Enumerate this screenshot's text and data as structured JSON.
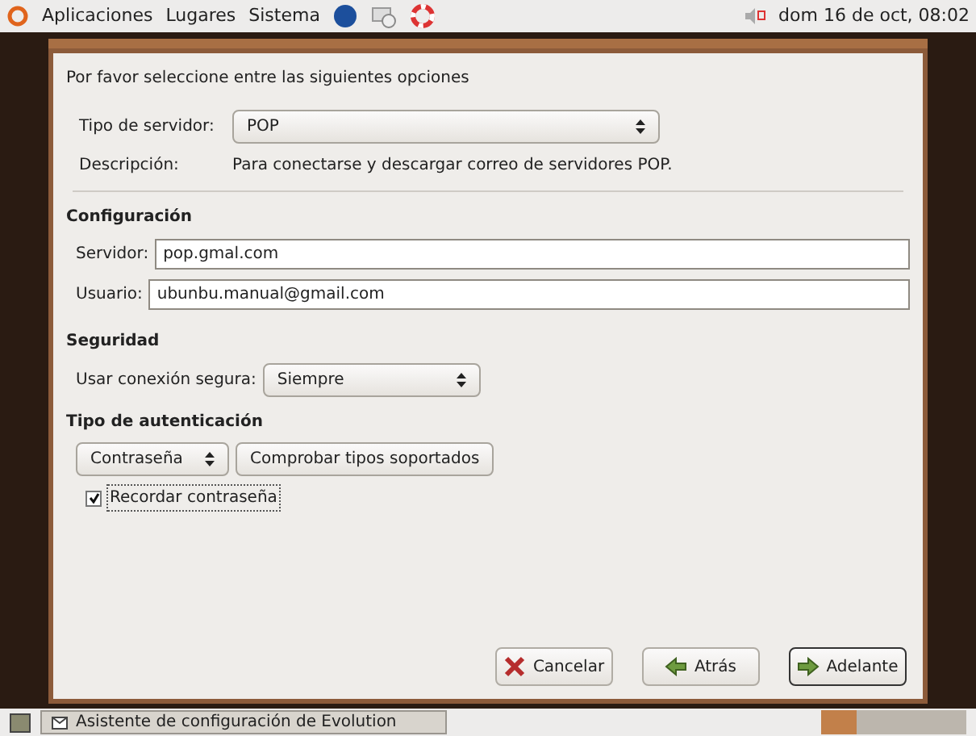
{
  "top_panel": {
    "menus": [
      "Aplicaciones",
      "Lugares",
      "Sistema"
    ],
    "clock": "dom 16 de oct, 08:02"
  },
  "intro": "Por favor seleccione entre las siguientes opciones",
  "server_type": {
    "label": "Tipo de servidor:",
    "value": "POP"
  },
  "description": {
    "label": "Descripción:",
    "text": "Para conectarse y descargar correo de servidores POP."
  },
  "configuration": {
    "title": "Configuración",
    "fields": [
      {
        "label": "Servidor:",
        "value": "pop.gmal.com"
      },
      {
        "label": "Usuario:",
        "value": "ubunbu.manual@gmail.com"
      }
    ]
  },
  "security": {
    "title": "Seguridad",
    "label": "Usar conexión segura:",
    "value": "Siempre"
  },
  "auth": {
    "title": "Tipo de autenticación",
    "value": "Contraseña",
    "check_button": "Comprobar tipos soportados",
    "remember": {
      "label": "Recordar contraseña",
      "checked": true
    }
  },
  "buttons": [
    {
      "kind": "cancel",
      "label": "Cancelar",
      "selected": false
    },
    {
      "kind": "back",
      "label": "Atrás",
      "selected": false
    },
    {
      "kind": "forward",
      "label": "Adelante",
      "selected": true
    }
  ],
  "taskbar": {
    "window": "Asistente de configuración de Evolution"
  }
}
